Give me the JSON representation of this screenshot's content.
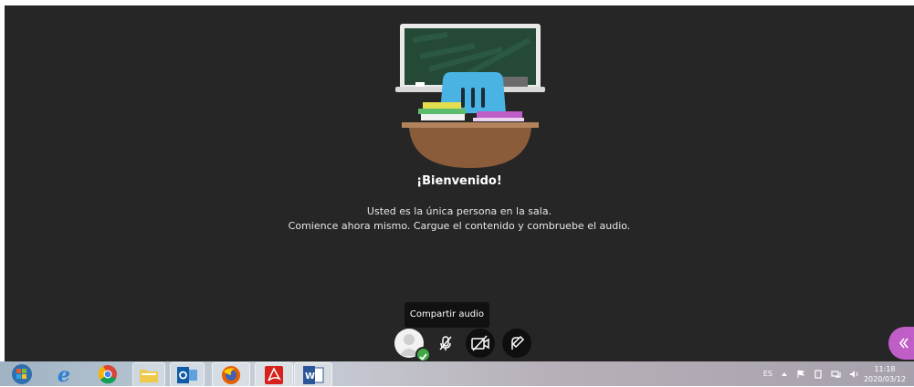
{
  "welcome": {
    "title": "¡Bienvenido!",
    "line1": "Usted es la única persona en la sala.",
    "line2": "Comience ahora mismo. Cargue el contenido y combruebe el audio."
  },
  "tooltip": "Compartir audio",
  "controls": [
    "user-avatar",
    "microphone-off-icon",
    "camera-off-icon",
    "share-content-icon"
  ],
  "collab_panel_icon": "double-chevron-left-icon",
  "taskbar": {
    "apps": [
      "start-orb",
      "internet-explorer",
      "chrome",
      "file-explorer",
      "outlook",
      "firefox",
      "acrobat",
      "word"
    ],
    "language": "ES",
    "time": "11:18",
    "date": "2020/03/12"
  },
  "colors": {
    "background": "#262626",
    "collab_tab": "#c05ec8",
    "status_ok": "#3fa845"
  }
}
